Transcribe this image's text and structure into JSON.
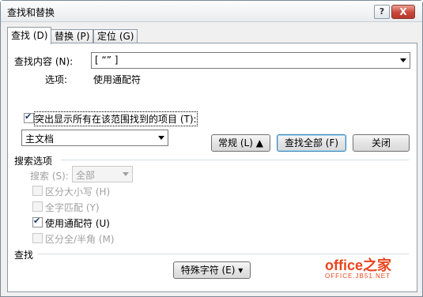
{
  "window": {
    "title": "查找和替换",
    "help": "?",
    "close": "X"
  },
  "tabs": [
    {
      "label": "查找 (D)",
      "active": true
    },
    {
      "label": "替换 (P)",
      "active": false
    },
    {
      "label": "定位 (G)",
      "active": false
    }
  ],
  "find": {
    "label": "查找内容 (N):",
    "value": "[ “” ]",
    "options_label": "选项:",
    "options_value": "使用通配符"
  },
  "highlight": {
    "checkbox_label": "突出显示所有在该范围找到的项目 (T):",
    "checked": true,
    "scope_value": "主文档"
  },
  "buttons": {
    "less": "常规 (L) ▲",
    "find_all": "查找全部 (F)",
    "close": "关闭",
    "special": "特殊字符 (E) ▾"
  },
  "search_options": {
    "header": "搜索选项",
    "search_label": "搜索 (S):",
    "search_value": "全部",
    "match_case": "区分大小写 (H)",
    "whole_word": "全字匹配 (Y)",
    "wildcards": "使用通配符 (U)",
    "width": "区分全/半角 (M)"
  },
  "find_section": {
    "header": "查找"
  },
  "watermark": {
    "brand": "office之家",
    "url": "OFFICE.JB51.NET"
  },
  "colors": {
    "accent_watermark": "#e8451e",
    "title_close": "#c9473a"
  }
}
